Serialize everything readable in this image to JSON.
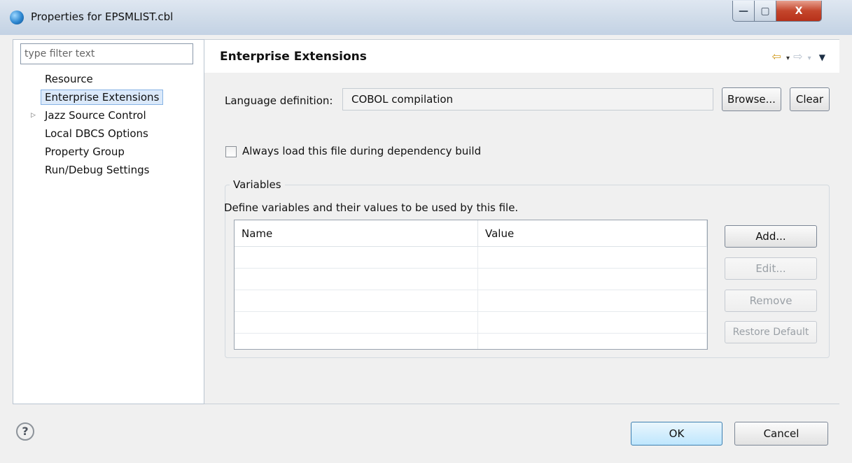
{
  "window": {
    "title": "Properties for EPSMLIST.cbl",
    "minimize_glyph": "—",
    "maximize_glyph": "▢",
    "close_glyph": "X"
  },
  "filter": {
    "placeholder": "type filter text",
    "value": ""
  },
  "nav": {
    "items": [
      {
        "label": "Resource"
      },
      {
        "label": "Enterprise Extensions",
        "selected": true
      },
      {
        "label": "Jazz Source Control",
        "expandable": true
      },
      {
        "label": "Local DBCS Options"
      },
      {
        "label": "Property Group"
      },
      {
        "label": "Run/Debug Settings"
      }
    ]
  },
  "page": {
    "title": "Enterprise Extensions",
    "nav_icons": {
      "back": "⇦",
      "forward": "⇨",
      "dropdown": "▾",
      "menu": "▼"
    },
    "language": {
      "label": "Language definition:",
      "value": "COBOL compilation",
      "browse_label": "Browse...",
      "clear_label": "Clear"
    },
    "always_load": {
      "label": "Always load this file during dependency build",
      "checked": false
    },
    "variables": {
      "legend": "Variables",
      "description": "Define variables and their values to be used by this file.",
      "columns": [
        "Name",
        "Value"
      ],
      "rows": [],
      "add_label": "Add...",
      "edit_label": "Edit...",
      "remove_label": "Remove",
      "restore_label": "Restore Default"
    }
  },
  "footer": {
    "help_glyph": "?",
    "ok_label": "OK",
    "cancel_label": "Cancel"
  },
  "colors": {
    "selection_bg": "#dbe9fa",
    "selection_border": "#87b3e5",
    "back_arrow": "#d09a1c",
    "close_button": "#c4462c"
  },
  "icons": {
    "title": "eclipse-globe-icon",
    "help": "help-circle-icon",
    "expander": "triangle-right-icon"
  }
}
